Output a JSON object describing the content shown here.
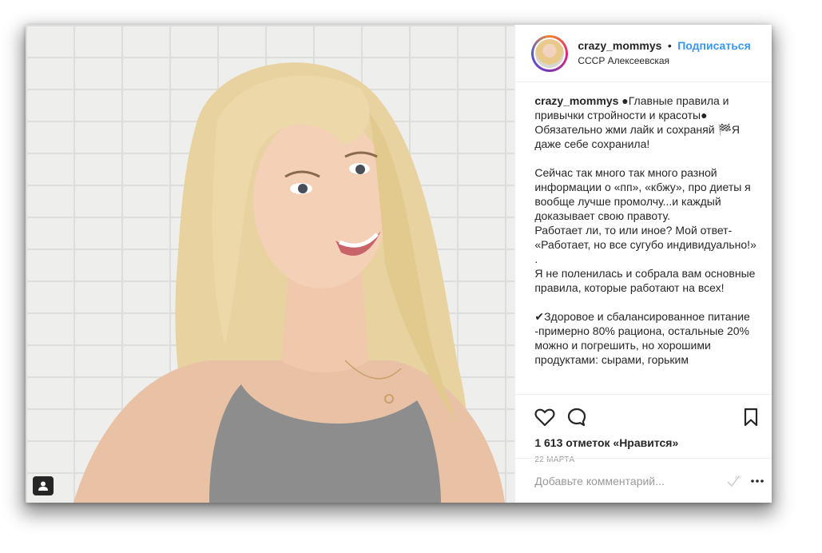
{
  "post": {
    "username": "crazy_mommys",
    "separator": "•",
    "follow_label": "Подписаться",
    "location": "СССР Алексеевская",
    "caption_user": "crazy_mommys",
    "caption_text": " ●Главные правила и привычки стройности и красоты● Обязательно жми лайк и сохраняй 🏁Я даже себе сохранила!\n\nСейчас так много так много разной информации о «пп», «кбжу», про диеты я вообще лучше промолчу...и каждый доказывает свою правоту.\nРаботает ли, то или иное? Мой ответ- «Работает, но все сугубо индивидуально!» .\nЯ не поленилась и собрала вам основные правила, которые работают на всех!\n\n✔Здоровое и сбалансированное питание -примерно 80% рациона, остальные 20% можно и погрешить, но хорошими продуктами: сырами, горьким",
    "likes": "1 613 отметок «Нравится»",
    "date": "22 МАРТА",
    "comment_placeholder": "Добавьте комментарий..."
  },
  "icons": {
    "like": "heart-icon",
    "comment": "comment-icon",
    "save": "bookmark-icon",
    "more": "more-options-icon",
    "tag": "user-tag-icon",
    "emoji": "checkmark-icon"
  },
  "colors": {
    "link": "#3897f0",
    "text": "#262626",
    "muted": "#999999"
  }
}
